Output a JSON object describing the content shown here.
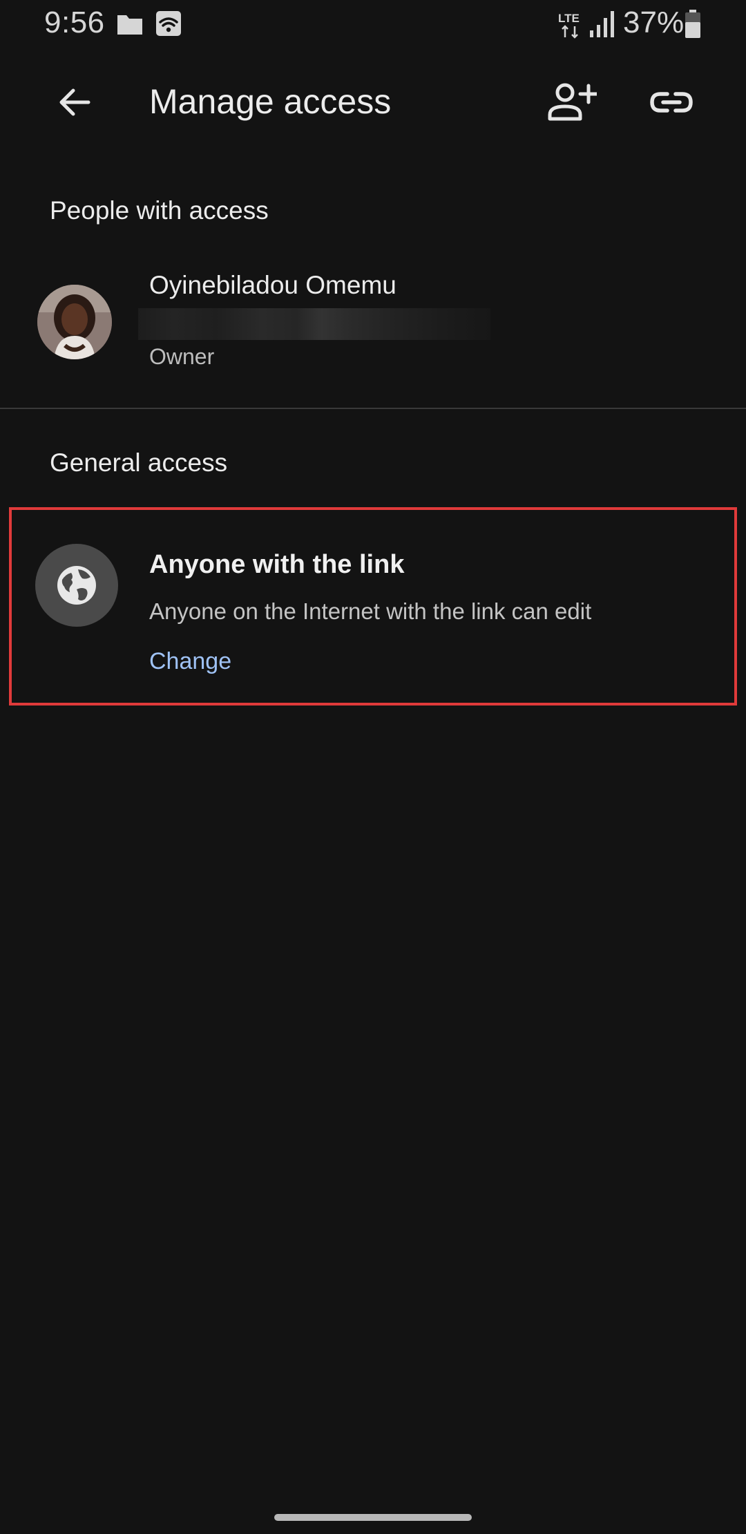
{
  "status_bar": {
    "time": "9:56",
    "network": "LTE",
    "battery": "37%",
    "icons": [
      "folder-icon",
      "wifi-icon",
      "lte-icon",
      "signal-icon",
      "battery-icon"
    ]
  },
  "app_bar": {
    "title": "Manage access",
    "back_icon": "arrow-back-icon",
    "add_person_icon": "person-add-icon",
    "link_icon": "link-icon"
  },
  "people_section": {
    "header": "People with access",
    "people": [
      {
        "name": "Oyinebiladou Omemu",
        "role": "Owner"
      }
    ]
  },
  "general_access": {
    "header": "General access",
    "icon": "globe-icon",
    "title": "Anyone with the link",
    "description": "Anyone on the Internet with the link can edit",
    "change_label": "Change"
  },
  "colors": {
    "background": "#131313",
    "link": "#9fc2f5",
    "highlight_border": "#e03a3a"
  }
}
